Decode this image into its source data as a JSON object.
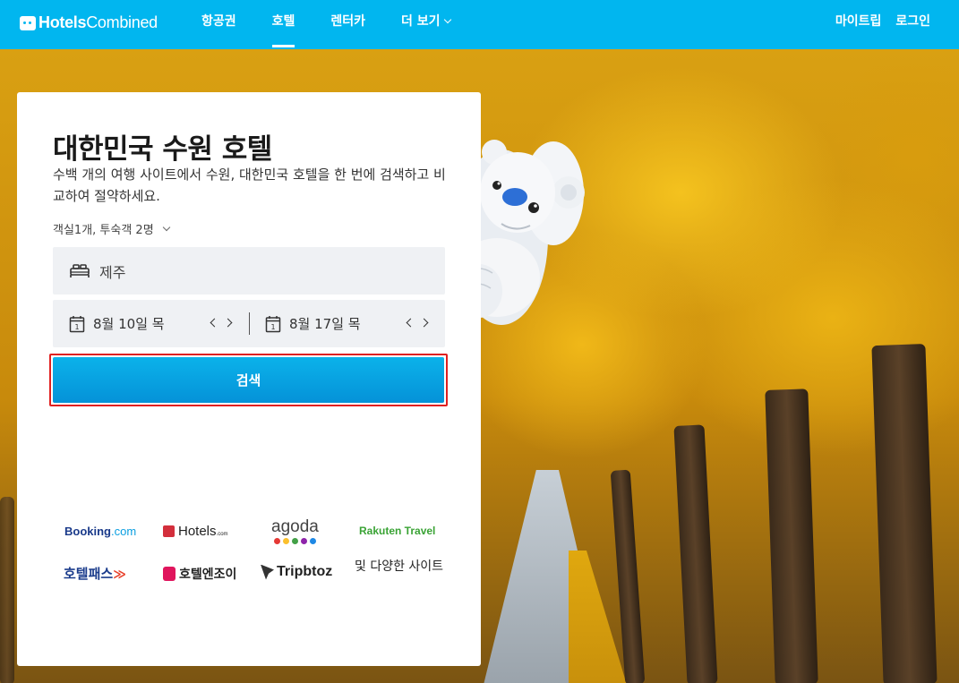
{
  "header": {
    "logo_bold": "Hotels",
    "logo_light": "Combined",
    "nav": [
      {
        "label": "항공권"
      },
      {
        "label": "호텔"
      },
      {
        "label": "렌터카"
      },
      {
        "label": "더 보기"
      }
    ],
    "right": [
      {
        "label": "마이트립"
      },
      {
        "label": "로그인"
      }
    ]
  },
  "card": {
    "title": "대한민국 수원 호텔",
    "subtitle": "수백 개의 여행 사이트에서 수원, 대한민국 호텔을 한 번에 검색하고 비교하여 절약하세요.",
    "guests": "객실1개, 투숙객 2명",
    "destination": "제주",
    "checkin": "8월 10일 목",
    "checkout": "8월 17일 목",
    "calendar_day": "1",
    "search_label": "검색"
  },
  "partners": {
    "booking": "Booking",
    "booking_suffix": ".com",
    "hotels": "Hotels",
    "hotels_suffix": ".com",
    "agoda": "agoda",
    "rakuten": "Rakuten Travel",
    "hotelpass": "호텔패스",
    "hotelenjoy": "호텔엔조이",
    "tripbtoz": "Tripbtoz",
    "more": "및 다양한 사이트"
  },
  "colors": {
    "header_bg": "#01b6ef",
    "search_button": "#0592d8",
    "highlight_border": "#e02020"
  }
}
